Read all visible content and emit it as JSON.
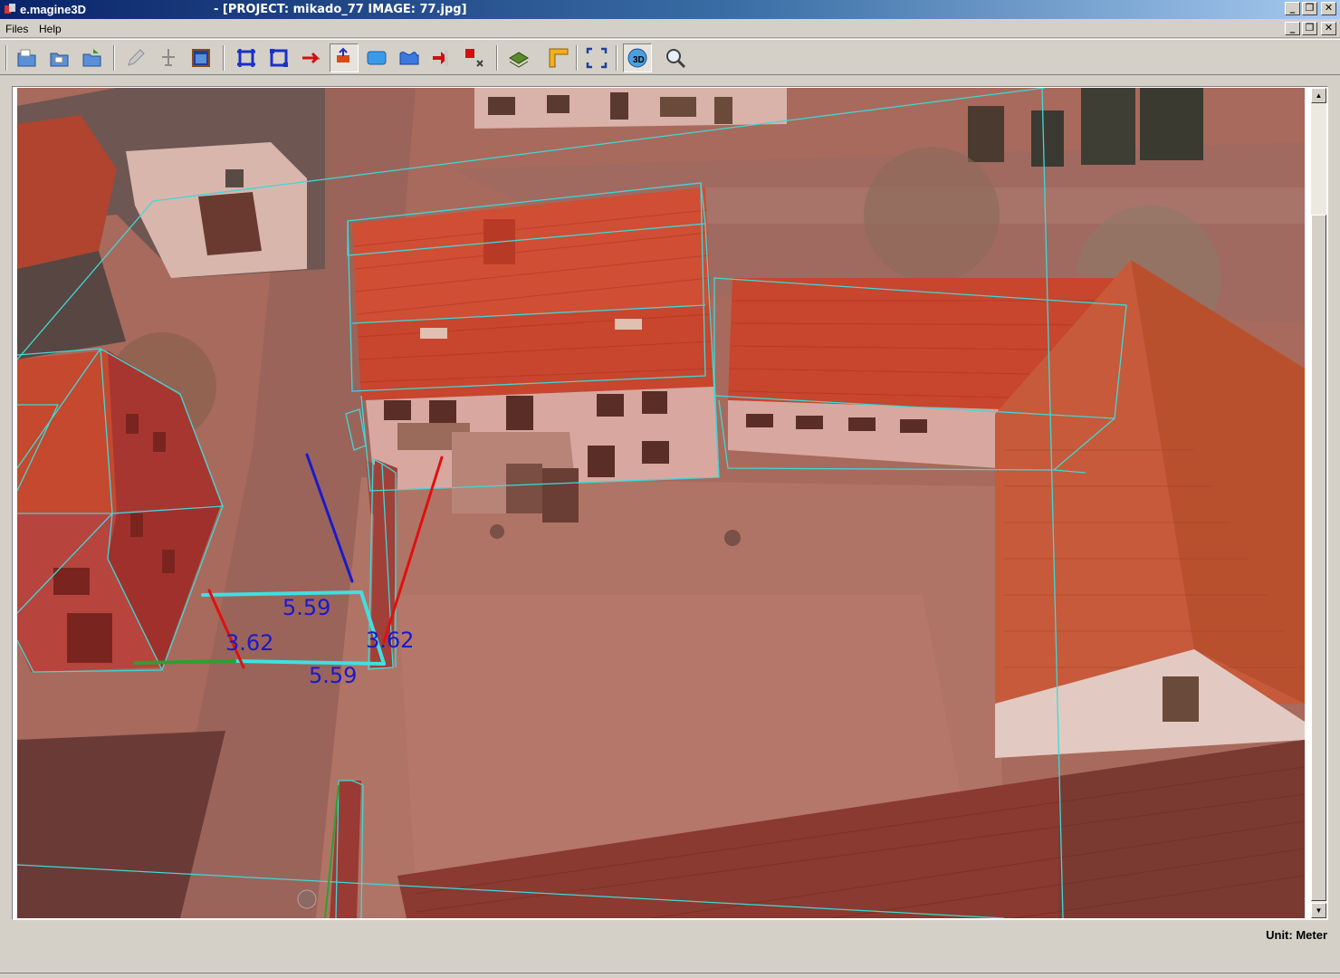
{
  "window": {
    "app_name": "e.magine3D",
    "title": "- [PROJECT: mikado_77 IMAGE: 77.jpg]",
    "controls": {
      "minimize": "_",
      "restore": "❐",
      "close": "✕"
    }
  },
  "menu": {
    "items": [
      "Files",
      "Help"
    ]
  },
  "toolbar": {
    "icons": [
      "open-folder-icon",
      "folder-icon",
      "open-project-icon",
      "pencil-icon",
      "pin-icon",
      "window-icon",
      "bounding-box-icon",
      "box-select-icon",
      "red-arrow-icon",
      "move-tool-icon",
      "blue-rect-icon",
      "wave-icon",
      "hand-pointer-icon",
      "corner-tool-icon",
      "layers-icon",
      "ruler-icon",
      "fit-screen-icon",
      "view-3d-icon",
      "zoom-icon"
    ],
    "view_3d_label": "3D"
  },
  "measurements": {
    "top_width": "5.59",
    "bottom_width": "5.59",
    "left_height": "3.62",
    "right_height": "3.62"
  },
  "status": {
    "unit": "Unit: Meter"
  },
  "colors": {
    "wireframe": "#3fd8d8",
    "measure_blue": "#1a1acc",
    "measure_red": "#e01010",
    "measure_green": "#2ea02e",
    "roof": "#c8452e"
  }
}
